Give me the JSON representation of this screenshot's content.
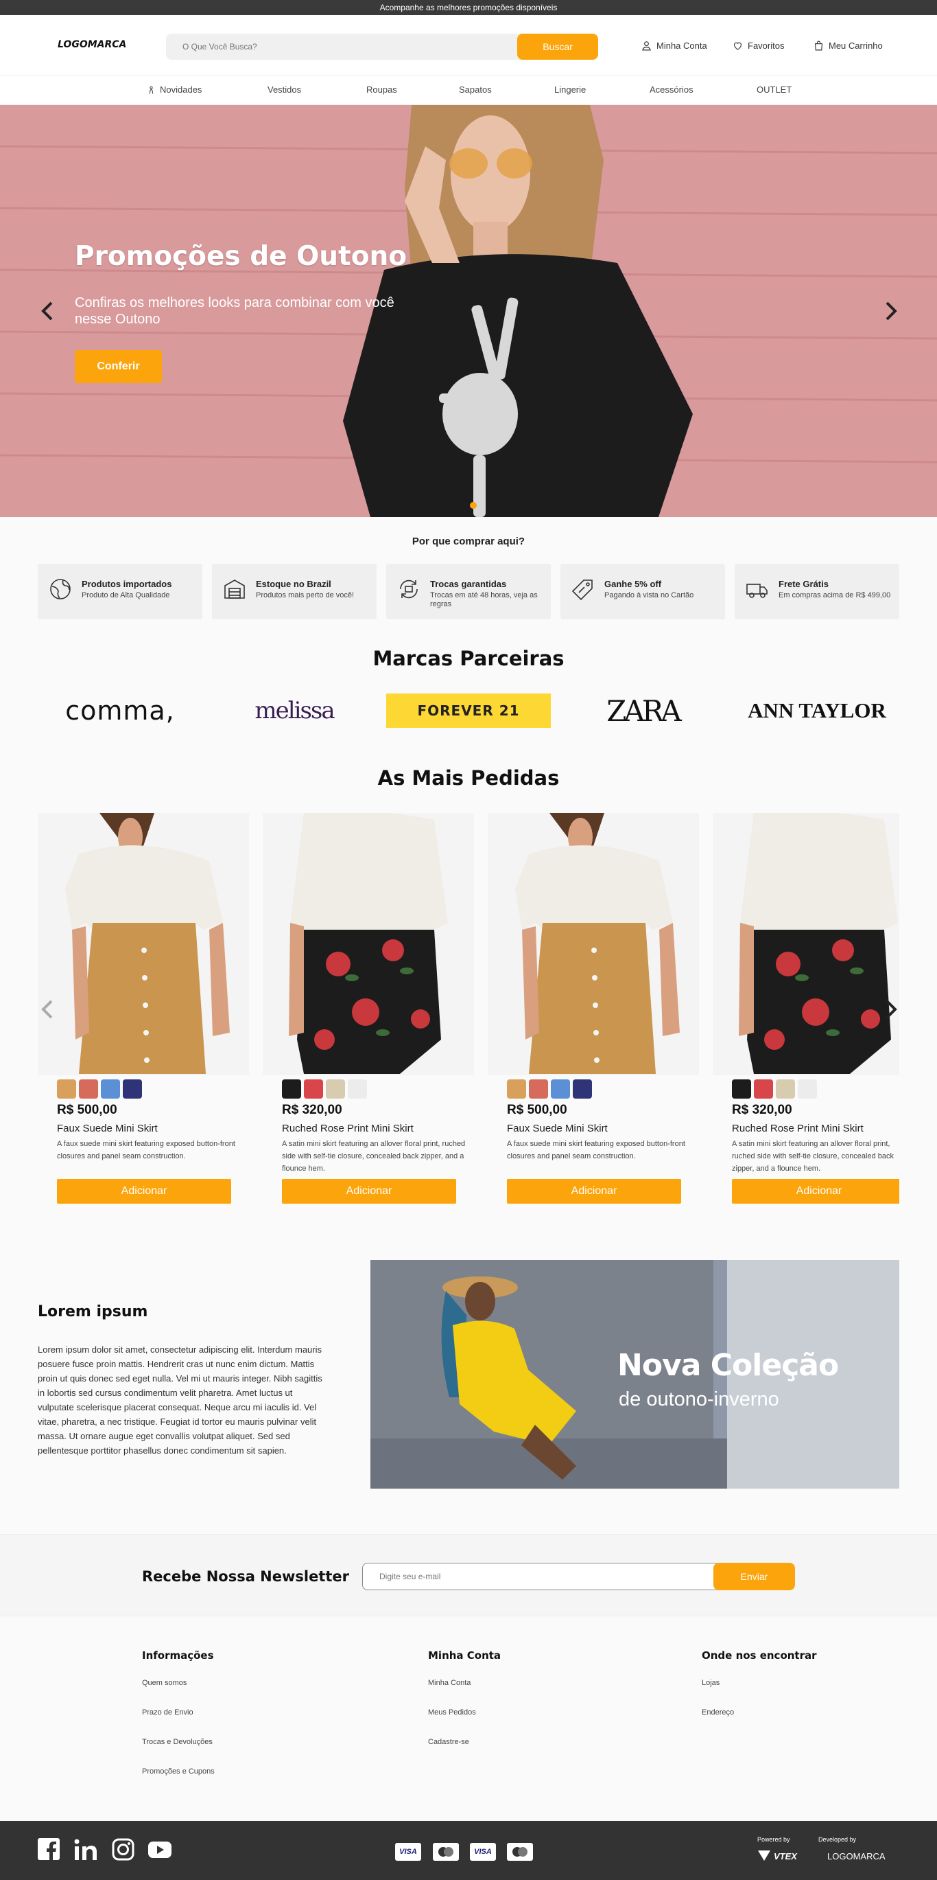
{
  "topbar": {
    "text": "Acompanhe as melhores promoções disponíveis"
  },
  "header": {
    "logo": "LOGOMARCA",
    "search_placeholder": "O Que Você Busca?",
    "search_button": "Buscar",
    "account": "Minha Conta",
    "favorites": "Favoritos",
    "cart": "Meu Carrinho"
  },
  "nav": {
    "items": [
      "Novidades",
      "Vestidos",
      "Roupas",
      "Sapatos",
      "Lingerie",
      "Acessórios",
      "OUTLET"
    ]
  },
  "hero": {
    "title": "Promoções de Outono",
    "subtitle": "Confiras os melhores looks para combinar com você nesse Outono",
    "button": "Conferir"
  },
  "why": {
    "title": "Por que comprar aqui?",
    "items": [
      {
        "title": "Produtos importados",
        "desc": "Produto de Alta Qualidade",
        "icon": "globe-icon"
      },
      {
        "title": "Estoque no Brazil",
        "desc": "Produtos mais perto de você!",
        "icon": "warehouse-icon"
      },
      {
        "title": "Trocas garantidas",
        "desc": "Trocas em até 48 horas, veja as regras",
        "icon": "exchange-icon"
      },
      {
        "title": "Ganhe 5% off",
        "desc": "Pagando à vista no Cartão",
        "icon": "discount-tag-icon"
      },
      {
        "title": "Frete Grátis",
        "desc": "Em compras acima de R$ 499,00",
        "icon": "truck-icon"
      }
    ]
  },
  "brands": {
    "title": "Marcas Parceiras",
    "items": [
      "comma,",
      "melissa",
      "FOREVER 21",
      "ZARA",
      "ANN TAYLOR"
    ]
  },
  "products": {
    "title": "As Mais Pedidas",
    "items": [
      {
        "price": "R$ 500,00",
        "name": "Faux Suede Mini Skirt",
        "desc": "A faux suede mini skirt featuring exposed button-front closures and panel seam construction.",
        "button": "Adicionar",
        "swatches": [
          "#d9a05c",
          "#d66b5c",
          "#5b8fd6",
          "#2e3477"
        ]
      },
      {
        "price": "R$ 320,00",
        "name": "Ruched Rose Print Mini Skirt",
        "desc": "A satin mini skirt featuring an allover floral print, ruched side with self-tie closure, concealed back zipper, and a flounce hem.",
        "button": "Adicionar",
        "swatches": [
          "#1c1c1c",
          "#d8454a",
          "#d8ccb0",
          "#ececec"
        ]
      },
      {
        "price": "R$ 500,00",
        "name": "Faux Suede Mini Skirt",
        "desc": "A faux suede mini skirt featuring exposed button-front closures and panel seam construction.",
        "button": "Adicionar",
        "swatches": [
          "#d9a05c",
          "#d66b5c",
          "#5b8fd6",
          "#2e3477"
        ]
      },
      {
        "price": "R$ 320,00",
        "name": "Ruched Rose Print Mini Skirt",
        "desc": "A satin mini skirt featuring an allover floral print, ruched side with self-tie closure, concealed back zipper, and a flounce hem.",
        "button": "Adicionar",
        "swatches": [
          "#1c1c1c",
          "#d8454a",
          "#d8ccb0",
          "#ececec"
        ]
      }
    ]
  },
  "lorem": {
    "title": "Lorem ipsum",
    "text": "Lorem ipsum dolor sit amet, consectetur adipiscing elit. Interdum mauris posuere fusce proin mattis. Hendrerit cras ut nunc enim dictum. Mattis proin ut quis donec sed eget nulla. Vel mi ut mauris integer. Nibh sagittis in lobortis sed cursus condimentum velit pharetra. Amet luctus ut vulputate scelerisque placerat consequat. Neque arcu mi iaculis id. Vel vitae, pharetra, a nec tristique. Feugiat id tortor eu mauris pulvinar velit massa. Ut ornare augue eget convallis volutpat aliquet. Sed sed pellentesque porttitor phasellus donec condimentum sit sapien."
  },
  "collection": {
    "title": "Nova Coleção",
    "subtitle": "de outono-inverno"
  },
  "newsletter": {
    "title": "Recebe Nossa Newsletter",
    "placeholder": "Digite seu e-mail",
    "button": "Enviar"
  },
  "footer": {
    "col1": {
      "title": "Informações",
      "links": [
        "Quem somos",
        "Prazo de Envio",
        "Trocas e Devoluções",
        "Promoções e Cupons"
      ]
    },
    "col2": {
      "title": "Minha Conta",
      "links": [
        "Minha Conta",
        "Meus Pedidos",
        "Cadastre-se"
      ]
    },
    "col3": {
      "title": "Onde nos encontrar",
      "links": [
        "Lojas",
        "Endereço"
      ]
    },
    "social": [
      "facebook-icon",
      "linkedin-icon",
      "instagram-icon",
      "youtube-icon"
    ],
    "payments": [
      "VISA",
      "mastercard",
      "VISA",
      "mastercard"
    ],
    "powered_by": "Powered by",
    "vtex": "VTEX",
    "developed_by": "Developed by",
    "dev_logo": "LOGOMARCA"
  },
  "colors": {
    "accent": "#fca40b",
    "dark": "#333333",
    "hero_bg": "#d99a9c"
  }
}
